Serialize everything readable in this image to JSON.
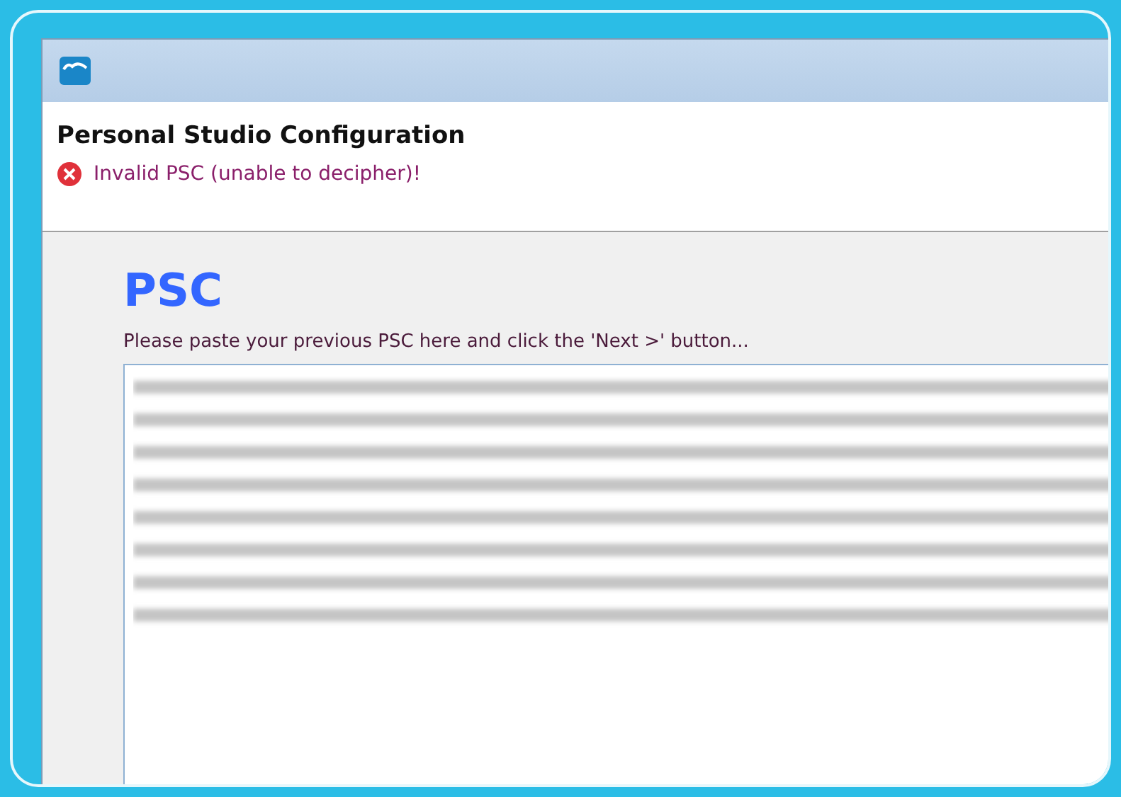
{
  "header": {
    "title": "Personal Studio Configuration",
    "error": "Invalid PSC (unable to decipher)!"
  },
  "section": {
    "heading": "PSC",
    "instruction": "Please paste your previous PSC here and click the 'Next >' button..."
  }
}
